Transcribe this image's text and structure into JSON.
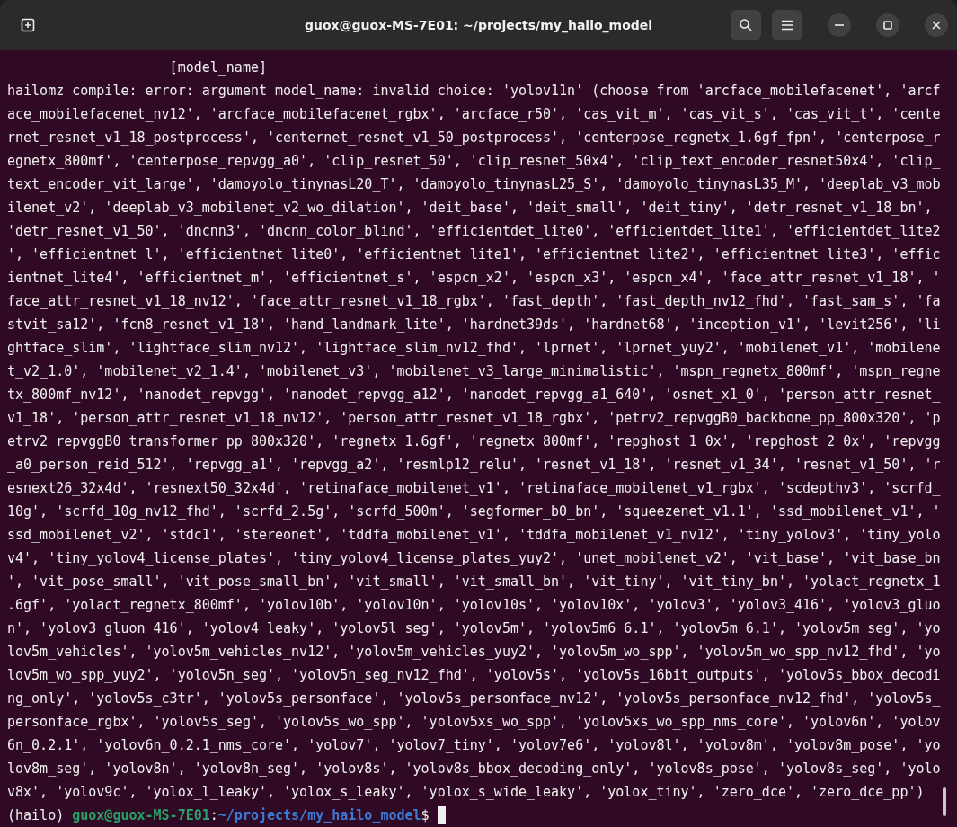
{
  "window": {
    "title": "guox@guox-MS-7E01: ~/projects/my_hailo_model"
  },
  "terminal": {
    "lines": [
      "                    [model_name]",
      "hailomz compile: error: argument model_name: invalid choice: 'yolov11n' (choose from 'arcface_mobilefacenet', 'arcf",
      "ace_mobilefacenet_nv12', 'arcface_mobilefacenet_rgbx', 'arcface_r50', 'cas_vit_m', 'cas_vit_s', 'cas_vit_t', 'cente",
      "rnet_resnet_v1_18_postprocess', 'centernet_resnet_v1_50_postprocess', 'centerpose_regnetx_1.6gf_fpn', 'centerpose_r",
      "egnetx_800mf', 'centerpose_repvgg_a0', 'clip_resnet_50', 'clip_resnet_50x4', 'clip_text_encoder_resnet50x4', 'clip_",
      "text_encoder_vit_large', 'damoyolo_tinynasL20_T', 'damoyolo_tinynasL25_S', 'damoyolo_tinynasL35_M', 'deeplab_v3_mob",
      "ilenet_v2', 'deeplab_v3_mobilenet_v2_wo_dilation', 'deit_base', 'deit_small', 'deit_tiny', 'detr_resnet_v1_18_bn',",
      "'detr_resnet_v1_50', 'dncnn3', 'dncnn_color_blind', 'efficientdet_lite0', 'efficientdet_lite1', 'efficientdet_lite2",
      "', 'efficientnet_l', 'efficientnet_lite0', 'efficientnet_lite1', 'efficientnet_lite2', 'efficientnet_lite3', 'effic",
      "ientnet_lite4', 'efficientnet_m', 'efficientnet_s', 'espcn_x2', 'espcn_x3', 'espcn_x4', 'face_attr_resnet_v1_18', '",
      "face_attr_resnet_v1_18_nv12', 'face_attr_resnet_v1_18_rgbx', 'fast_depth', 'fast_depth_nv12_fhd', 'fast_sam_s', 'fa",
      "stvit_sa12', 'fcn8_resnet_v1_18', 'hand_landmark_lite', 'hardnet39ds', 'hardnet68', 'inception_v1', 'levit256', 'li",
      "ghtface_slim', 'lightface_slim_nv12', 'lightface_slim_nv12_fhd', 'lprnet', 'lprnet_yuy2', 'mobilenet_v1', 'mobilene",
      "t_v2_1.0', 'mobilenet_v2_1.4', 'mobilenet_v3', 'mobilenet_v3_large_minimalistic', 'mspn_regnetx_800mf', 'mspn_regne",
      "tx_800mf_nv12', 'nanodet_repvgg', 'nanodet_repvgg_a12', 'nanodet_repvgg_a1_640', 'osnet_x1_0', 'person_attr_resnet_",
      "v1_18', 'person_attr_resnet_v1_18_nv12', 'person_attr_resnet_v1_18_rgbx', 'petrv2_repvggB0_backbone_pp_800x320', 'p",
      "etrv2_repvggB0_transformer_pp_800x320', 'regnetx_1.6gf', 'regnetx_800mf', 'repghost_1_0x', 'repghost_2_0x', 'repvgg",
      "_a0_person_reid_512', 'repvgg_a1', 'repvgg_a2', 'resmlp12_relu', 'resnet_v1_18', 'resnet_v1_34', 'resnet_v1_50', 'r",
      "esnext26_32x4d', 'resnext50_32x4d', 'retinaface_mobilenet_v1', 'retinaface_mobilenet_v1_rgbx', 'scdepthv3', 'scrfd_",
      "10g', 'scrfd_10g_nv12_fhd', 'scrfd_2.5g', 'scrfd_500m', 'segformer_b0_bn', 'squeezenet_v1.1', 'ssd_mobilenet_v1', '",
      "ssd_mobilenet_v2', 'stdc1', 'stereonet', 'tddfa_mobilenet_v1', 'tddfa_mobilenet_v1_nv12', 'tiny_yolov3', 'tiny_yolo",
      "v4', 'tiny_yolov4_license_plates', 'tiny_yolov4_license_plates_yuy2', 'unet_mobilenet_v2', 'vit_base', 'vit_base_bn",
      "', 'vit_pose_small', 'vit_pose_small_bn', 'vit_small', 'vit_small_bn', 'vit_tiny', 'vit_tiny_bn', 'yolact_regnetx_1",
      ".6gf', 'yolact_regnetx_800mf', 'yolov10b', 'yolov10n', 'yolov10s', 'yolov10x', 'yolov3', 'yolov3_416', 'yolov3_gluo",
      "n', 'yolov3_gluon_416', 'yolov4_leaky', 'yolov5l_seg', 'yolov5m', 'yolov5m6_6.1', 'yolov5m_6.1', 'yolov5m_seg', 'yo",
      "lov5m_vehicles', 'yolov5m_vehicles_nv12', 'yolov5m_vehicles_yuy2', 'yolov5m_wo_spp', 'yolov5m_wo_spp_nv12_fhd', 'yo",
      "lov5m_wo_spp_yuy2', 'yolov5n_seg', 'yolov5n_seg_nv12_fhd', 'yolov5s', 'yolov5s_16bit_outputs', 'yolov5s_bbox_decodi",
      "ng_only', 'yolov5s_c3tr', 'yolov5s_personface', 'yolov5s_personface_nv12', 'yolov5s_personface_nv12_fhd', 'yolov5s_",
      "personface_rgbx', 'yolov5s_seg', 'yolov5s_wo_spp', 'yolov5xs_wo_spp', 'yolov5xs_wo_spp_nms_core', 'yolov6n', 'yolov",
      "6n_0.2.1', 'yolov6n_0.2.1_nms_core', 'yolov7', 'yolov7_tiny', 'yolov7e6', 'yolov8l', 'yolov8m', 'yolov8m_pose', 'yo",
      "lov8m_seg', 'yolov8n', 'yolov8n_seg', 'yolov8s', 'yolov8s_bbox_decoding_only', 'yolov8s_pose', 'yolov8s_seg', 'yolo",
      "v8x', 'yolov9c', 'yolox_l_leaky', 'yolox_s_leaky', 'yolox_s_wide_leaky', 'yolox_tiny', 'zero_dce', 'zero_dce_pp')"
    ],
    "prompt": {
      "env": "(hailo)",
      "user_host": "guox@guox-MS-7E01",
      "separator": ":",
      "path": "~/projects/my_hailo_model",
      "symbol": "$"
    }
  }
}
